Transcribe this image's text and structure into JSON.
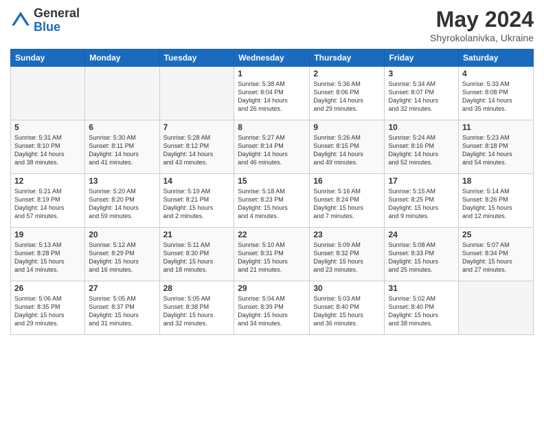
{
  "logo": {
    "general": "General",
    "blue": "Blue"
  },
  "title": "May 2024",
  "subtitle": "Shyrokolanivka, Ukraine",
  "columns": [
    "Sunday",
    "Monday",
    "Tuesday",
    "Wednesday",
    "Thursday",
    "Friday",
    "Saturday"
  ],
  "weeks": [
    [
      {
        "day": "",
        "info": ""
      },
      {
        "day": "",
        "info": ""
      },
      {
        "day": "",
        "info": ""
      },
      {
        "day": "1",
        "info": "Sunrise: 5:38 AM\nSunset: 8:04 PM\nDaylight: 14 hours\nand 26 minutes."
      },
      {
        "day": "2",
        "info": "Sunrise: 5:36 AM\nSunset: 8:06 PM\nDaylight: 14 hours\nand 29 minutes."
      },
      {
        "day": "3",
        "info": "Sunrise: 5:34 AM\nSunset: 8:07 PM\nDaylight: 14 hours\nand 32 minutes."
      },
      {
        "day": "4",
        "info": "Sunrise: 5:33 AM\nSunset: 8:08 PM\nDaylight: 14 hours\nand 35 minutes."
      }
    ],
    [
      {
        "day": "5",
        "info": "Sunrise: 5:31 AM\nSunset: 8:10 PM\nDaylight: 14 hours\nand 38 minutes."
      },
      {
        "day": "6",
        "info": "Sunrise: 5:30 AM\nSunset: 8:11 PM\nDaylight: 14 hours\nand 41 minutes."
      },
      {
        "day": "7",
        "info": "Sunrise: 5:28 AM\nSunset: 8:12 PM\nDaylight: 14 hours\nand 43 minutes."
      },
      {
        "day": "8",
        "info": "Sunrise: 5:27 AM\nSunset: 8:14 PM\nDaylight: 14 hours\nand 46 minutes."
      },
      {
        "day": "9",
        "info": "Sunrise: 5:26 AM\nSunset: 8:15 PM\nDaylight: 14 hours\nand 49 minutes."
      },
      {
        "day": "10",
        "info": "Sunrise: 5:24 AM\nSunset: 8:16 PM\nDaylight: 14 hours\nand 52 minutes."
      },
      {
        "day": "11",
        "info": "Sunrise: 5:23 AM\nSunset: 8:18 PM\nDaylight: 14 hours\nand 54 minutes."
      }
    ],
    [
      {
        "day": "12",
        "info": "Sunrise: 5:21 AM\nSunset: 8:19 PM\nDaylight: 14 hours\nand 57 minutes."
      },
      {
        "day": "13",
        "info": "Sunrise: 5:20 AM\nSunset: 8:20 PM\nDaylight: 14 hours\nand 59 minutes."
      },
      {
        "day": "14",
        "info": "Sunrise: 5:19 AM\nSunset: 8:21 PM\nDaylight: 15 hours\nand 2 minutes."
      },
      {
        "day": "15",
        "info": "Sunrise: 5:18 AM\nSunset: 8:23 PM\nDaylight: 15 hours\nand 4 minutes."
      },
      {
        "day": "16",
        "info": "Sunrise: 5:16 AM\nSunset: 8:24 PM\nDaylight: 15 hours\nand 7 minutes."
      },
      {
        "day": "17",
        "info": "Sunrise: 5:15 AM\nSunset: 8:25 PM\nDaylight: 15 hours\nand 9 minutes."
      },
      {
        "day": "18",
        "info": "Sunrise: 5:14 AM\nSunset: 8:26 PM\nDaylight: 15 hours\nand 12 minutes."
      }
    ],
    [
      {
        "day": "19",
        "info": "Sunrise: 5:13 AM\nSunset: 8:28 PM\nDaylight: 15 hours\nand 14 minutes."
      },
      {
        "day": "20",
        "info": "Sunrise: 5:12 AM\nSunset: 8:29 PM\nDaylight: 15 hours\nand 16 minutes."
      },
      {
        "day": "21",
        "info": "Sunrise: 5:11 AM\nSunset: 8:30 PM\nDaylight: 15 hours\nand 18 minutes."
      },
      {
        "day": "22",
        "info": "Sunrise: 5:10 AM\nSunset: 8:31 PM\nDaylight: 15 hours\nand 21 minutes."
      },
      {
        "day": "23",
        "info": "Sunrise: 5:09 AM\nSunset: 8:32 PM\nDaylight: 15 hours\nand 23 minutes."
      },
      {
        "day": "24",
        "info": "Sunrise: 5:08 AM\nSunset: 8:33 PM\nDaylight: 15 hours\nand 25 minutes."
      },
      {
        "day": "25",
        "info": "Sunrise: 5:07 AM\nSunset: 8:34 PM\nDaylight: 15 hours\nand 27 minutes."
      }
    ],
    [
      {
        "day": "26",
        "info": "Sunrise: 5:06 AM\nSunset: 8:35 PM\nDaylight: 15 hours\nand 29 minutes."
      },
      {
        "day": "27",
        "info": "Sunrise: 5:05 AM\nSunset: 8:37 PM\nDaylight: 15 hours\nand 31 minutes."
      },
      {
        "day": "28",
        "info": "Sunrise: 5:05 AM\nSunset: 8:38 PM\nDaylight: 15 hours\nand 32 minutes."
      },
      {
        "day": "29",
        "info": "Sunrise: 5:04 AM\nSunset: 8:39 PM\nDaylight: 15 hours\nand 34 minutes."
      },
      {
        "day": "30",
        "info": "Sunrise: 5:03 AM\nSunset: 8:40 PM\nDaylight: 15 hours\nand 36 minutes."
      },
      {
        "day": "31",
        "info": "Sunrise: 5:02 AM\nSunset: 8:40 PM\nDaylight: 15 hours\nand 38 minutes."
      },
      {
        "day": "",
        "info": ""
      }
    ]
  ]
}
